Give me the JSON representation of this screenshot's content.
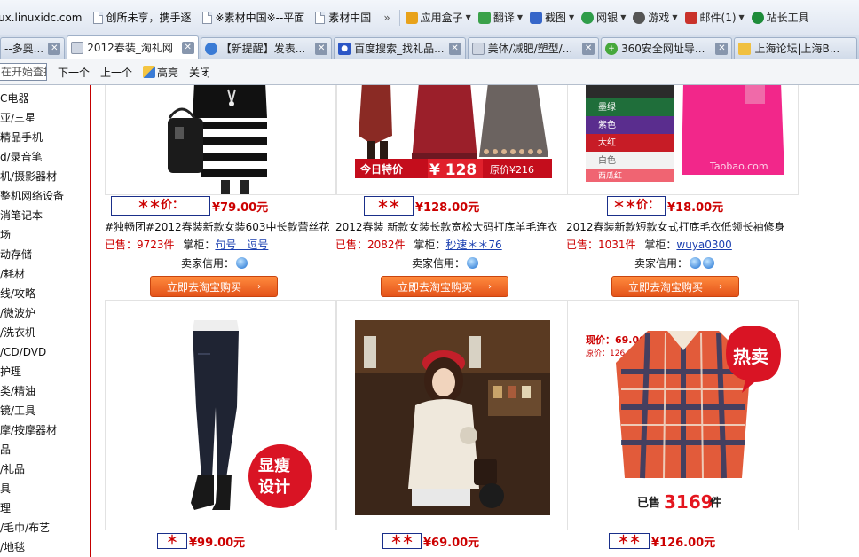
{
  "bookmarks": {
    "url_fragment": "ux.linuxidc.com",
    "items": [
      "创所未享，携手逐",
      "※素材中国※--平面",
      "素材中国"
    ],
    "more": "»",
    "tools": [
      {
        "label": "应用盒子",
        "icon": "app-box-icon",
        "color": "#e8a21b"
      },
      {
        "label": "翻译",
        "icon": "translate-icon",
        "color": "#3aa14a"
      },
      {
        "label": "截图",
        "icon": "screenshot-icon",
        "color": "#3666c9"
      },
      {
        "label": "网银",
        "icon": "netbank-icon",
        "color": "#2f9d4a"
      },
      {
        "label": "游戏",
        "icon": "game-icon",
        "color": "#555"
      },
      {
        "label": "邮件(1)",
        "icon": "mail-icon",
        "color": "#c9322b"
      },
      {
        "label": "站长工具",
        "icon": "webmaster-icon",
        "color": "#1e8c3a"
      }
    ]
  },
  "tabs": [
    {
      "label": "--多奥...",
      "icon_color": "#7b8aa3"
    },
    {
      "label": "2012春装_淘礼网",
      "icon_color": "#cfd6e2",
      "active": true
    },
    {
      "label": "【新提醒】发表...",
      "icon_color": "#3a7bd5"
    },
    {
      "label": "百度搜索_找礼品...",
      "icon_color": "#2b56c6"
    },
    {
      "label": "美体/减肥/塑型/...",
      "icon_color": "#cfd6e2"
    },
    {
      "label": "360安全网址导...",
      "icon_color": "#46a83c"
    },
    {
      "label": "上海论坛|上海B...",
      "icon_color": "#f0c040"
    }
  ],
  "findbar": {
    "input_placeholder": "在开始查找",
    "next": "下一个",
    "prev": "上一个",
    "highlight": "高亮",
    "close": "关闭"
  },
  "sidebar": {
    "categories": [
      "C电器",
      "亚/三星",
      "精品手机",
      "d/录音笔",
      "机/摄影器材",
      "整机网络设备",
      "消笔记本",
      "场",
      "动存储",
      "/耗材",
      "线/攻略",
      "/微波炉",
      "/洗衣机",
      "/CD/DVD",
      "护理",
      "类/精油",
      "镜/工具",
      "摩/按摩器材",
      "品",
      "/礼品",
      "具",
      "理",
      "/毛巾/布艺",
      "/地毯"
    ]
  },
  "products_top": [
    {
      "price_label": "＊＊价：",
      "price": "¥79.00元",
      "title": "#独畅团#2012春装新款女装603中长款蕾丝花",
      "sold_label": "已售：",
      "sold_count": "9723件",
      "shop_label": "掌柜：",
      "shop_name": "句号　逗号",
      "credit_label": "卖家信用：",
      "buy": "立即去淘宝购买"
    },
    {
      "price_label": "＊＊价：",
      "price": "¥128.00元",
      "title": "2012春装 新款女装长款宽松大码打底羊毛连衣",
      "sold_label": "已售：",
      "sold_count": "2082件",
      "shop_label": "掌柜：",
      "shop_name": "秒速＊＊76",
      "credit_label": "卖家信用：",
      "buy": "立即去淘宝购买",
      "banner_left": "今日特价",
      "banner_price": "¥ 128",
      "banner_right": "原价¥216"
    },
    {
      "price_label": "＊＊价：",
      "price": "¥18.00元",
      "title": "2012春装新款短款女式打底毛衣低领长袖修身",
      "sold_label": "已售：",
      "sold_count": "1031件",
      "shop_label": "掌柜：",
      "shop_name": "wuya0300",
      "credit_label": "卖家信用：",
      "buy": "立即去淘宝购买",
      "swatches": [
        "墨绿",
        "紫色",
        "大红",
        "白色",
        "西瓜红"
      ],
      "watermark": "Taobao.com"
    }
  ],
  "products_bottom": [
    {
      "price_label": "＊＊价：",
      "price": "¥99.00元",
      "badge_line1": "显瘦",
      "badge_line2": "设计"
    },
    {
      "price_label": "＊＊价：",
      "price": "¥69.00元"
    },
    {
      "price_label": "＊＊价：",
      "price": "¥126.00元",
      "now_price": "现价：69.00",
      "orig_price": "原价：126",
      "hot": "热卖",
      "sold_prefix": "已售",
      "sold_num": "3169",
      "sold_suffix": "件"
    }
  ],
  "colors": {
    "brand_red": "#c00000",
    "buy_orange": "#f26a26",
    "link_blue": "#1a3fb0"
  }
}
